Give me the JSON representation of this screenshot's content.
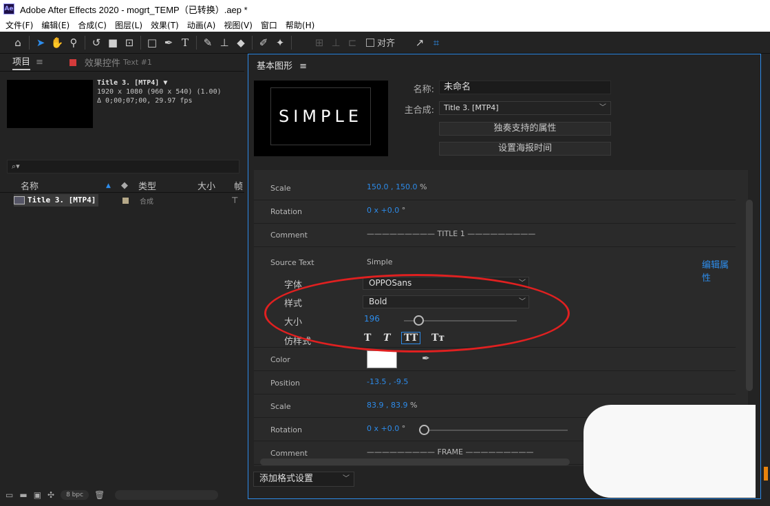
{
  "window": {
    "title": "Adobe After Effects 2020 - mogrt_TEMP（已转换）.aep *",
    "logo": "Ae"
  },
  "menu": [
    "文件(F)",
    "编辑(E)",
    "合成(C)",
    "图层(L)",
    "效果(T)",
    "动画(A)",
    "视图(V)",
    "窗口",
    "帮助(H)"
  ],
  "toolbar": {
    "align_label": "对齐"
  },
  "project_panel": {
    "tab_project": "项目",
    "tab_menu": "≡",
    "tab_effects": "效果控件",
    "tab_effects_sub": "Text #1",
    "comp_name": "Title 3. [MTP4] ▼",
    "comp_size": "1920 x 1080  (960 x 540) (1.00)",
    "comp_duration": "Δ 0;00;07;00, 29.97 fps",
    "search_placeholder": "⌕▾",
    "col_name": "名称",
    "col_type": "类型",
    "col_size": "大小",
    "col_frame": "帧",
    "item_name": "Title 3. [MTP4]",
    "item_type": "合成",
    "bpc": "8 bpc"
  },
  "eg_panel": {
    "title": "基本图形",
    "menu": "≡",
    "preview_text": "SIMPLE",
    "name_label": "名称:",
    "name_value": "未命名",
    "master_label": "主合成:",
    "master_value": "Title 3. [MTP4]",
    "solo_button": "独奏支持的属性",
    "poster_button": "设置海报时间",
    "edit_props": "编辑属性",
    "add_format": "添加格式设置"
  },
  "properties": {
    "scale1_label": "Scale",
    "scale1_value": "150.0 , 150.0",
    "scale1_unit": "%",
    "rotation1_label": "Rotation",
    "rotation1_value": "0 x +0.0",
    "rotation1_unit": "°",
    "comment1_label": "Comment",
    "comment1_text": "————————— TITLE 1 —————————",
    "source_text_label": "Source Text",
    "source_text_value": "Simple",
    "font_label": "字体",
    "font_value": "OPPOSans",
    "style_label": "样式",
    "style_value": "Bold",
    "size_label": "大小",
    "size_value": "196",
    "faux_label": "仿样式",
    "faux_bold": "T",
    "faux_italic": "T",
    "faux_allcaps": "TT",
    "faux_smallcaps": "Tт",
    "color_label": "Color",
    "position_label": "Position",
    "position_value": "-13.5 , -9.5",
    "scale2_label": "Scale",
    "scale2_value": "83.9 , 83.9",
    "scale2_unit": "%",
    "rotation2_label": "Rotation",
    "rotation2_value": "0 x +0.0",
    "rotation2_unit": "°",
    "comment2_label": "Comment",
    "comment2_text": "————————— FRAME —————————"
  },
  "colors": {
    "accent": "#2d8ceb",
    "highlight_ellipse": "#e02020",
    "text_color_swatch": "#ffffff"
  },
  "icons": [
    "home-icon",
    "selection-arrow-icon",
    "hand-icon",
    "zoom-icon",
    "rotate-icon",
    "camera-icon",
    "pan-behind-icon",
    "rectangle-icon",
    "pen-icon",
    "type-icon",
    "brush-icon",
    "clone-stamp-icon",
    "eraser-icon",
    "roto-brush-icon",
    "puppet-pin-icon"
  ]
}
